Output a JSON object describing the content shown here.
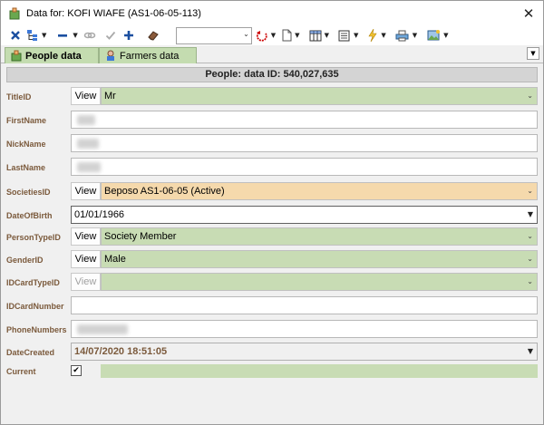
{
  "window": {
    "title": "Data for: KOFI WIAFE  (AS1-06-05-113)",
    "close_glyph": "✕"
  },
  "toolbar": {
    "icons": [
      "close-x-icon",
      "tree-icon",
      "remove-icon",
      "link-icon",
      "confirm-icon",
      "add-icon",
      "eraser-icon",
      "undo-icon",
      "new-page-icon",
      "grid-icon",
      "form-icon",
      "lightning-icon",
      "print-icon",
      "image-icon"
    ],
    "combo_value": ""
  },
  "tabs": [
    {
      "label": "People data",
      "active": true
    },
    {
      "label": "Farmers data",
      "active": false
    }
  ],
  "header": {
    "text": "People: data ID: 540,027,635"
  },
  "form": {
    "view_label": "View",
    "title_id": {
      "label": "TitleID",
      "value": "Mr"
    },
    "first_name": {
      "label": "FirstName"
    },
    "nick_name": {
      "label": "NickName"
    },
    "last_name": {
      "label": "LastName"
    },
    "societies_id": {
      "label": "SocietiesID",
      "value": "Beposo AS1-06-05 (Active)"
    },
    "date_of_birth": {
      "label": "DateOfBirth",
      "value": "01/01/1966"
    },
    "person_type_id": {
      "label": "PersonTypeID",
      "value": "Society Member"
    },
    "gender_id": {
      "label": "GenderID",
      "value": "Male"
    },
    "id_card_type_id": {
      "label": "IDCardTypeID",
      "value": ""
    },
    "id_card_number": {
      "label": "IDCardNumber",
      "value": ""
    },
    "phone_numbers": {
      "label": "PhoneNumbers"
    },
    "date_created": {
      "label": "DateCreated",
      "value": "14/07/2020 18:51:05"
    },
    "current": {
      "label": "Current",
      "checked": true,
      "check_glyph": "✔"
    }
  },
  "colors": {
    "label": "#7b5a3c",
    "green_field": "#c8dcb4",
    "tan_field": "#f5d9ac",
    "tab_green": "#c4dcb0"
  }
}
